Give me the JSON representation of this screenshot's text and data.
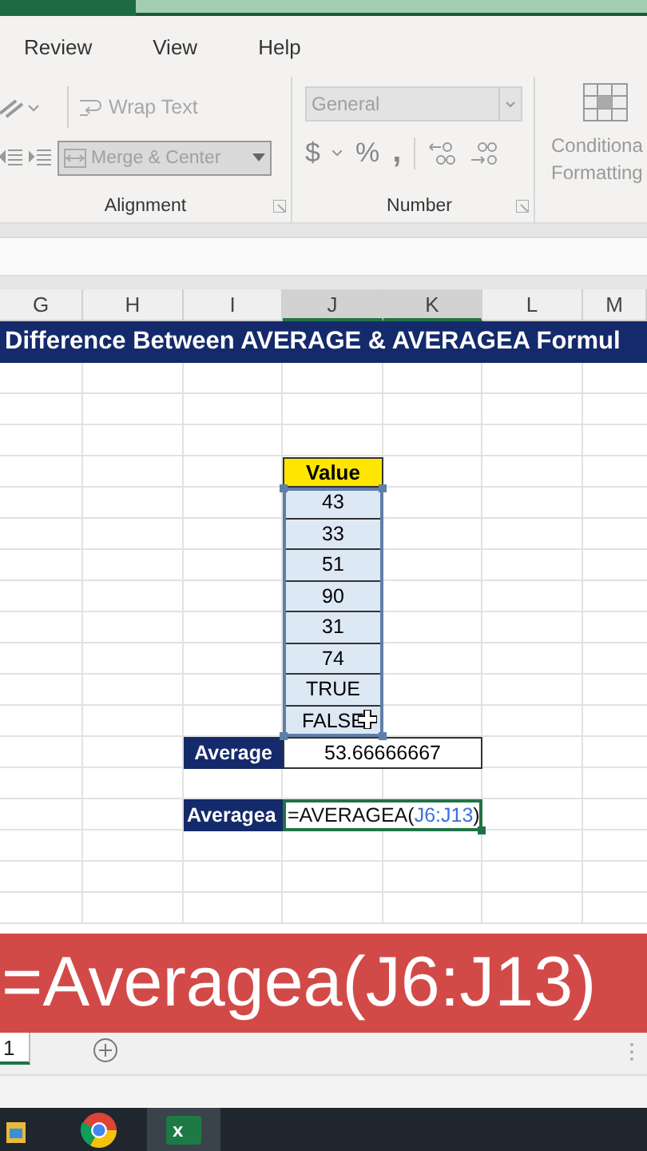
{
  "ribbon_tabs": [
    {
      "label": "Review"
    },
    {
      "label": "View"
    },
    {
      "label": "Help"
    }
  ],
  "alignment_group": {
    "label": "Alignment",
    "wrap_text": {
      "label": "Wrap Text",
      "disabled": true
    },
    "merge_center": {
      "label": "Merge & Center",
      "disabled": true
    }
  },
  "number_group": {
    "label": "Number",
    "format": {
      "value": "General",
      "disabled": true
    },
    "symbols": [
      "$",
      "%",
      ","
    ]
  },
  "conditional_formatting": {
    "lines": [
      "Conditiona",
      "Formatting"
    ],
    "disabled": true
  },
  "columns": [
    {
      "label": "G",
      "selected": false
    },
    {
      "label": "H",
      "selected": false
    },
    {
      "label": "I",
      "selected": false
    },
    {
      "label": "J",
      "selected": true
    },
    {
      "label": "K",
      "selected": true
    },
    {
      "label": "L",
      "selected": false
    },
    {
      "label": "M",
      "selected": false
    }
  ],
  "banner": "Difference Between AVERAGE & AVERAGEA Formul",
  "values": {
    "header": "Value",
    "items": [
      "43",
      "33",
      "51",
      "90",
      "31",
      "74",
      "TRUE",
      "FALSE"
    ]
  },
  "average": {
    "label": "Average",
    "value": "53.66666667"
  },
  "averagea": {
    "label": "Averagea",
    "formula": [
      {
        "text": "=AVERAGEA(",
        "kind": "plain"
      },
      {
        "text": "J6:J13",
        "kind": "ref"
      },
      {
        "text": ")",
        "kind": "plain"
      }
    ]
  },
  "caption": "=Averagea(J6:J13)",
  "sheet_tabs": [
    {
      "label": "1",
      "selected": true
    }
  ],
  "taskbar": [
    {
      "kind": "folder",
      "selected": false
    },
    {
      "kind": "browser",
      "selected": false
    },
    {
      "kind": "spreadsheet",
      "label": "x",
      "selected": true
    }
  ]
}
